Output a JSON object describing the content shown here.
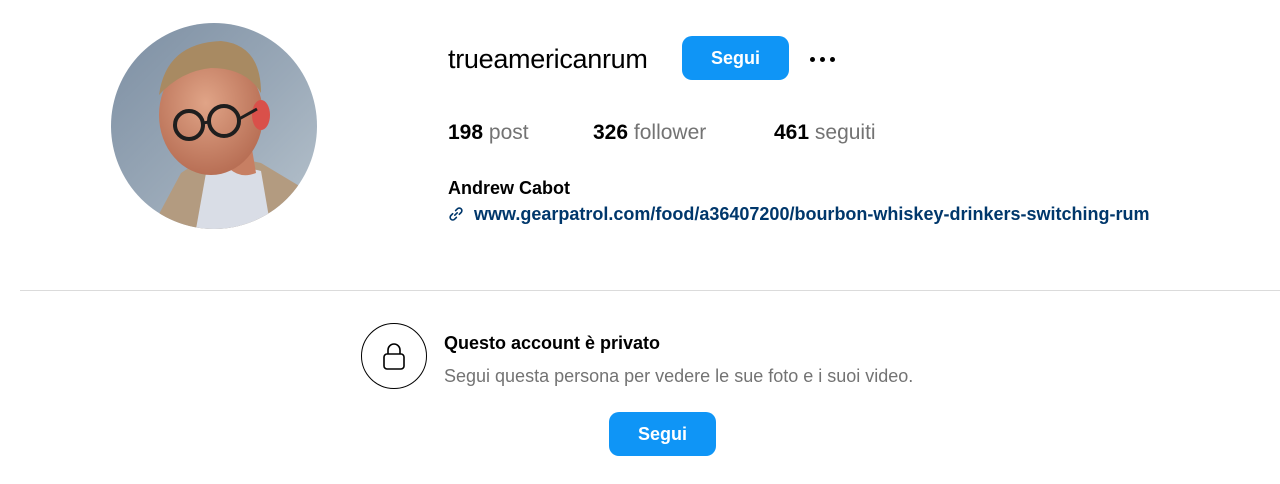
{
  "profile": {
    "username": "trueamericanrum",
    "follow_label": "Segui",
    "more_icon": "more-horizontal-icon",
    "stats": {
      "posts_count": "198",
      "posts_label": "post",
      "followers_count": "326",
      "followers_label": "follower",
      "following_count": "461",
      "following_label": "seguiti"
    },
    "full_name": "Andrew Cabot",
    "link_icon": "link-icon",
    "link_text": "www.gearpatrol.com/food/a36407200/bourbon-whiskey-drinkers-switching-rum"
  },
  "private_notice": {
    "icon": "lock-icon",
    "title": "Questo account è privato",
    "subtitle": "Segui questa persona per vedere le sue foto e i suoi video.",
    "follow_label": "Segui"
  },
  "colors": {
    "accent": "#0f95f6",
    "link": "#00376b",
    "secondary_text": "#737373",
    "divider": "#dbdbdb"
  }
}
